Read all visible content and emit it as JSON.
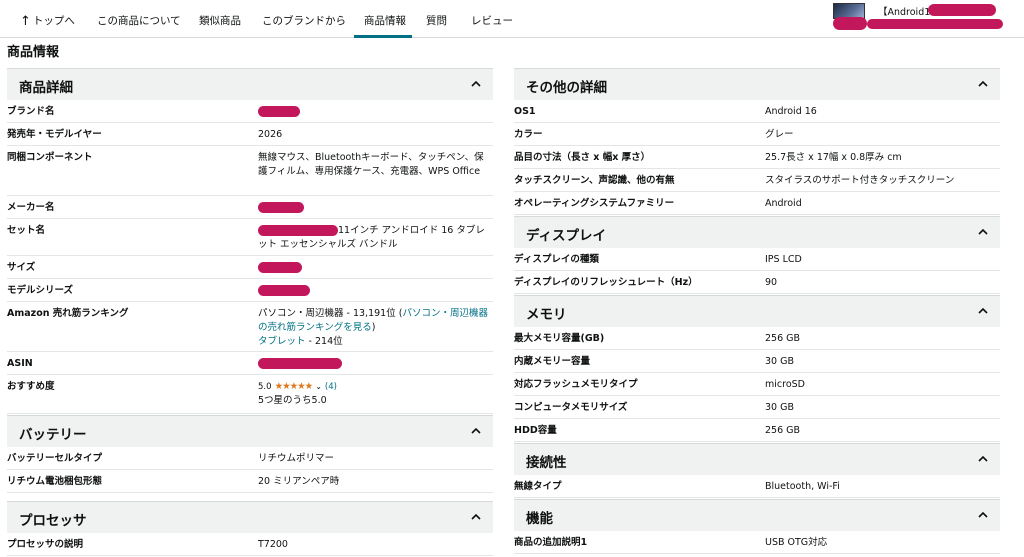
{
  "nav": {
    "back": "トップへ",
    "tabs": [
      "この商品について",
      "類似商品",
      "このブランドから",
      "商品情報",
      "質問",
      "レビュー"
    ],
    "active": "商品情報",
    "product_title": "【Android16"
  },
  "page_title": "商品情報",
  "left": [
    {
      "title": "商品詳細",
      "rows": [
        {
          "k": "ブランド名",
          "v": ""
        },
        {
          "k": "発売年・モデルイヤー",
          "v": "2026"
        },
        {
          "k": "同梱コンポーネント",
          "v": "無線マウス、Bluetoothキーボード、タッチペン、保護フィルム、専用保護ケース、充電器、WPS Office"
        },
        {
          "k": "メーカー名",
          "v": ""
        },
        {
          "k": "セット名",
          "v": "11インチ アンドロイド 16 タブレット エッセンシャルズ バンドル"
        },
        {
          "k": "サイズ",
          "v": ""
        },
        {
          "k": "モデルシリーズ",
          "v": ""
        },
        {
          "k": "Amazon 売れ筋ランキング",
          "v1": "パソコン・周辺機器 - 13,191位 (",
          "v1_link": "パソコン・周辺機器の売れ筋ランキングを見る",
          "v1_end": ")",
          "v2_link": "タブレット",
          "v2": " - 214位"
        },
        {
          "k": "ASIN",
          "v": ""
        },
        {
          "k": "おすすめ度",
          "rating": "5.0",
          "stars": "★★★★★",
          "count": "(4)",
          "sub": "5つ星のうち5.0"
        }
      ]
    },
    {
      "title": "バッテリー",
      "rows": [
        {
          "k": "バッテリーセルタイプ",
          "v": "リチウムポリマー"
        },
        {
          "k": "リチウム電池梱包形態",
          "v": "20 ミリアンペア時"
        }
      ]
    },
    {
      "title": "プロセッサ",
      "rows": [
        {
          "k": "プロセッサの説明",
          "v": "T7200"
        }
      ]
    }
  ],
  "right": [
    {
      "title": "その他の詳細",
      "rows": [
        {
          "k": "OS1",
          "v": "Android 16"
        },
        {
          "k": "カラー",
          "v": "グレー"
        },
        {
          "k": "品目の寸法（長さ x 幅x 厚さ）",
          "v": "25.7長さ x 17幅 x 0.8厚み cm"
        },
        {
          "k": "タッチスクリーン、声認識、他の有無",
          "v": "スタイラスのサポート付きタッチスクリーン"
        },
        {
          "k": "オペレーティングシステムファミリー",
          "v": "Android"
        }
      ]
    },
    {
      "title": "ディスプレイ",
      "rows": [
        {
          "k": "ディスプレイの種類",
          "v": "IPS LCD"
        },
        {
          "k": "ディスプレイのリフレッシュレート（Hz）",
          "v": "90"
        }
      ]
    },
    {
      "title": "メモリ",
      "rows": [
        {
          "k": "最大メモリ容量(GB)",
          "v": "256 GB"
        },
        {
          "k": "内蔵メモリー容量",
          "v": "30 GB"
        },
        {
          "k": "対応フラッシュメモリタイプ",
          "v": "microSD"
        },
        {
          "k": "コンピュータメモリサイズ",
          "v": "30 GB"
        },
        {
          "k": "HDD容量",
          "v": "256 GB"
        }
      ]
    },
    {
      "title": "接続性",
      "rows": [
        {
          "k": "無線タイプ",
          "v": "Bluetooth, Wi-Fi"
        }
      ]
    },
    {
      "title": "機能",
      "rows": [
        {
          "k": "商品の追加説明1",
          "v": "USB OTG対応"
        }
      ]
    }
  ],
  "colors": {
    "accent": "#007185",
    "star": "#de7921",
    "redaction": "#c2185b",
    "section_bg": "#f0f2f2"
  }
}
